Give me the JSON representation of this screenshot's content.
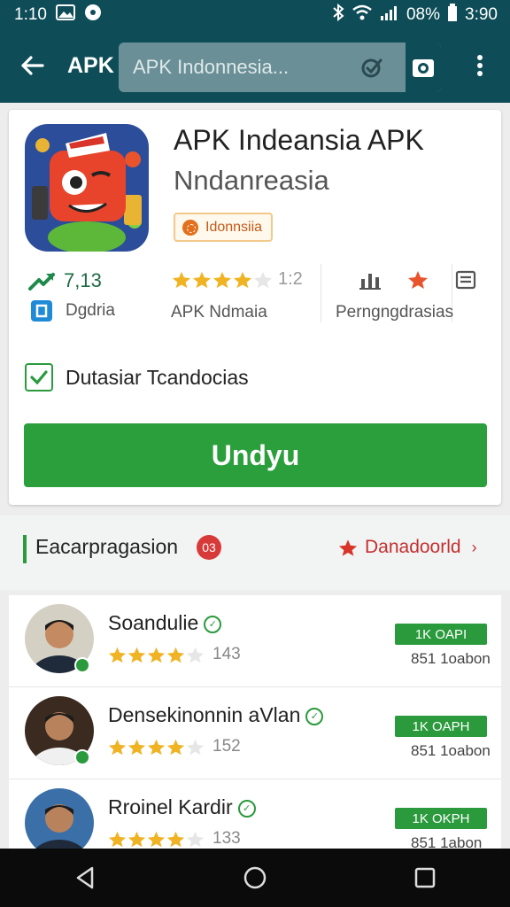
{
  "status_bar": {
    "time": "1:10",
    "battery_percent": "08%",
    "clock_right": "3:90"
  },
  "app_bar": {
    "title": "APK",
    "search_value": "APK Indonnesia..."
  },
  "app": {
    "title": "APK Indeansia APK",
    "subtitle": "Nndanreasia",
    "badge": "Idonnsiia",
    "trend_value": "7,13",
    "rating_value": "1:2",
    "rating_stars": 4,
    "category": "Dgdria",
    "developer": "APK Ndmaia",
    "permissions": "Perngngdrasias",
    "checkbox_label": "Dutasiar Tcandocias",
    "checkbox_checked": true,
    "download_label": "Undyu"
  },
  "section": {
    "title": "Eacarpragasion",
    "count_badge": "03",
    "link_label": "Danadoorld",
    "link_chevron": "›"
  },
  "reviews": [
    {
      "name": "Soandulie",
      "rating_count": "143",
      "stars": 4,
      "tag": "1K OAPI",
      "sub": "851 1oabon"
    },
    {
      "name": "Densekinonnin aVlan",
      "rating_count": "152",
      "stars": 4,
      "tag": "1K OAPH",
      "sub": "851 1oabon"
    },
    {
      "name": "Rroinel Kardir",
      "rating_count": "133",
      "stars": 4,
      "tag": "1K OKPH",
      "sub": "851 1abon"
    }
  ],
  "colors": {
    "app_bar": "#0e4d57",
    "accent_green": "#2c9f3d",
    "accent_red": "#c42f2f",
    "star": "#f0b323"
  },
  "icons": {
    "back": "arrow-left-icon",
    "overflow": "more-vert-icon",
    "camera": "camera-icon",
    "clear": "search-clear-icon"
  }
}
